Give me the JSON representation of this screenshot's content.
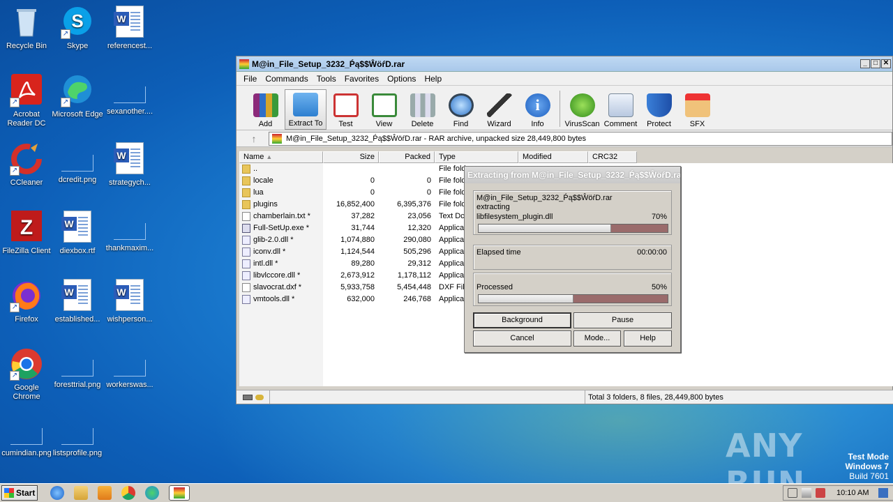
{
  "desktop": {
    "icons": [
      {
        "label": "Recycle Bin"
      },
      {
        "label": "Skype"
      },
      {
        "label": "referencest..."
      },
      {
        "label": "Acrobat Reader DC"
      },
      {
        "label": "Microsoft Edge"
      },
      {
        "label": "sexanother...."
      },
      {
        "label": "CCleaner"
      },
      {
        "label": "dcredit.png"
      },
      {
        "label": "strategych..."
      },
      {
        "label": "FileZilla Client"
      },
      {
        "label": "diexbox.rtf"
      },
      {
        "label": "thankmaxim..."
      },
      {
        "label": "Firefox"
      },
      {
        "label": "established..."
      },
      {
        "label": "wishperson..."
      },
      {
        "label": "Google Chrome"
      },
      {
        "label": "foresttrial.png"
      },
      {
        "label": "workerswas..."
      },
      {
        "label": "cumindian.png"
      },
      {
        "label": "listsprofile.png"
      }
    ]
  },
  "window": {
    "title": "M@in_File_Setup_3232_Ṕą$$ŴöŕD.rar",
    "menu": [
      "File",
      "Commands",
      "Tools",
      "Favorites",
      "Options",
      "Help"
    ],
    "toolbar": [
      "Add",
      "Extract To",
      "Test",
      "View",
      "Delete",
      "Find",
      "Wizard",
      "Info",
      "VirusScan",
      "Comment",
      "Protect",
      "SFX"
    ],
    "address": "M@in_File_Setup_3232_Ṕą$$ŴöŕD.rar - RAR archive, unpacked size 28,449,800 bytes",
    "columns": [
      "Name",
      "Size",
      "Packed",
      "Type",
      "Modified",
      "CRC32"
    ],
    "files": [
      {
        "name": "..",
        "size": "",
        "packed": "",
        "type": "File fold",
        "icon": "folder"
      },
      {
        "name": "locale",
        "size": "0",
        "packed": "0",
        "type": "File fold",
        "icon": "folder"
      },
      {
        "name": "lua",
        "size": "0",
        "packed": "0",
        "type": "File fold",
        "icon": "folder"
      },
      {
        "name": "plugins",
        "size": "16,852,400",
        "packed": "6,395,376",
        "type": "File fold",
        "icon": "folder"
      },
      {
        "name": "chamberlain.txt *",
        "size": "37,282",
        "packed": "23,056",
        "type": "Text Dc",
        "icon": "file"
      },
      {
        "name": "Full-SetUp.exe *",
        "size": "31,744",
        "packed": "12,320",
        "type": "Applicat",
        "icon": "exe"
      },
      {
        "name": "glib-2.0.dll *",
        "size": "1,074,880",
        "packed": "290,080",
        "type": "Applicat",
        "icon": "dll"
      },
      {
        "name": "iconv.dll *",
        "size": "1,124,544",
        "packed": "505,296",
        "type": "Applicat",
        "icon": "dll"
      },
      {
        "name": "intl.dll *",
        "size": "89,280",
        "packed": "29,312",
        "type": "Applicat",
        "icon": "dll"
      },
      {
        "name": "libvlccore.dll *",
        "size": "2,673,912",
        "packed": "1,178,112",
        "type": "Applicat",
        "icon": "dll"
      },
      {
        "name": "slavocrat.dxf *",
        "size": "5,933,758",
        "packed": "5,454,448",
        "type": "DXF File",
        "icon": "file"
      },
      {
        "name": "vmtools.dll *",
        "size": "632,000",
        "packed": "246,768",
        "type": "Applicat",
        "icon": "dll"
      }
    ],
    "status": "Total 3 folders, 8 files, 28,449,800 bytes"
  },
  "dialog": {
    "title": "Extracting from M@in_File_Setup_3232_Ṕą$$ŴöŕD.rar",
    "archive": "M@in_File_Setup_3232_Ṕą$$ŴöŕD.rar",
    "action": "extracting",
    "current_file": "libfilesystem_plugin.dll",
    "file_percent_label": "70%",
    "file_progress": 0.7,
    "elapsed_label": "Elapsed time",
    "elapsed_value": "00:00:00",
    "processed_label": "Processed",
    "processed_percent_label": "50%",
    "processed_progress": 0.5,
    "buttons": {
      "background": "Background",
      "pause": "Pause",
      "cancel": "Cancel",
      "mode": "Mode...",
      "help": "Help"
    }
  },
  "taskbar": {
    "start": "Start",
    "clock": "10:10 AM"
  },
  "watermark": "ANY RUN",
  "test_mode": {
    "line1": "Test Mode",
    "line2": "Windows 7",
    "line3": "Build 7601"
  }
}
